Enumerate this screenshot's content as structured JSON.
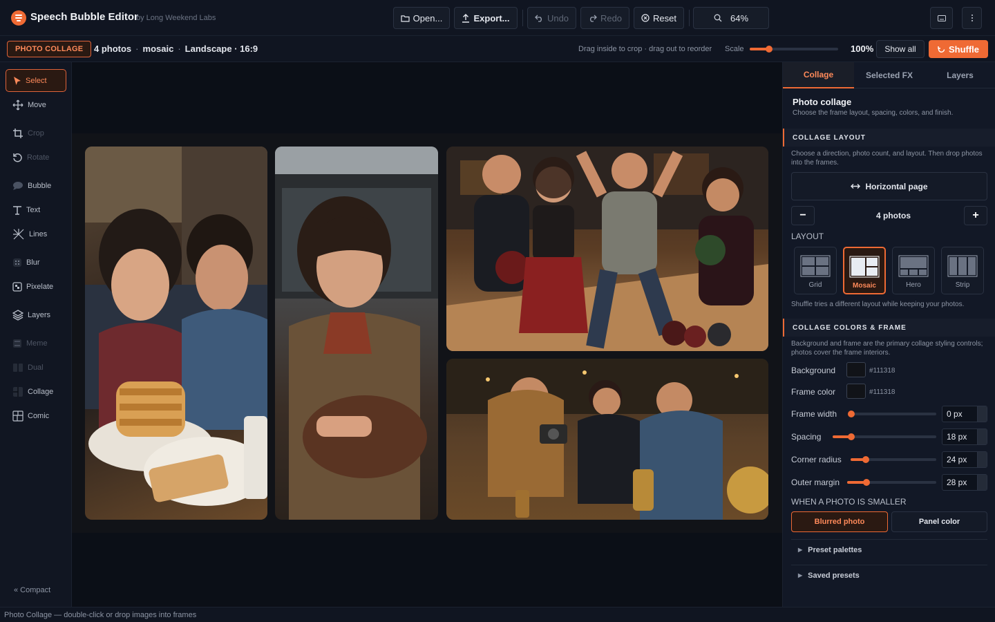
{
  "app": {
    "title": "Speech Bubble Editor",
    "subtitle": "by Long Weekend Labs"
  },
  "toolbar": {
    "open": "Open...",
    "export": "Export...",
    "undo": "Undo",
    "redo": "Redo",
    "reset": "Reset",
    "zoom": "64%"
  },
  "subbar": {
    "mode": "PHOTO COLLAGE",
    "photos": "4 photos",
    "layout": "mosaic",
    "orientation": "Landscape · 16:9",
    "hint": "Drag inside to crop · drag out to reorder",
    "scale_label": "Scale",
    "scale_level": 0.22,
    "scale_value": "100%",
    "show_all": "Show all",
    "shuffle": "Shuffle"
  },
  "tools": [
    {
      "label": "Select",
      "icon": "cursor-icon",
      "active": true,
      "enabled": true
    },
    {
      "label": "Move",
      "icon": "move-icon",
      "enabled": true
    },
    {
      "label": "Crop",
      "icon": "crop-icon",
      "enabled": false
    },
    {
      "label": "Rotate",
      "icon": "rotate-icon",
      "enabled": false
    },
    {
      "label": "Bubble",
      "icon": "bubble-icon",
      "enabled": true
    },
    {
      "label": "Text",
      "icon": "text-icon",
      "enabled": true
    },
    {
      "label": "Lines",
      "icon": "lines-icon",
      "enabled": true
    },
    {
      "label": "Blur",
      "icon": "blur-icon",
      "enabled": true
    },
    {
      "label": "Pixelate",
      "icon": "pixelate-icon",
      "enabled": true
    },
    {
      "label": "Layers",
      "icon": "layers-icon",
      "enabled": true
    },
    {
      "label": "Meme",
      "icon": "meme-icon",
      "enabled": false
    },
    {
      "label": "Dual",
      "icon": "dual-icon",
      "enabled": false
    },
    {
      "label": "Collage",
      "icon": "collage-icon",
      "enabled": true
    },
    {
      "label": "Comic",
      "icon": "comic-icon",
      "enabled": true
    }
  ],
  "compact": "« Compact",
  "panel": {
    "tabs": [
      "Collage",
      "Selected FX",
      "Layers"
    ],
    "title": "Photo collage",
    "desc": "Choose the frame layout, spacing, colors, and finish.",
    "layout_section": "COLLAGE LAYOUT",
    "layout_help": "Choose a direction, photo count, and layout. Then drop photos into the frames.",
    "direction": "Horizontal page",
    "count": "4 photos",
    "layout_label": "LAYOUT",
    "layouts": [
      "Grid",
      "Mosaic",
      "Hero",
      "Strip"
    ],
    "layout_note": "Shuffle tries a different layout while keeping your photos.",
    "colors_section": "COLLAGE COLORS & FRAME",
    "colors_help": "Background and frame are the primary collage styling controls; photos cover the frame interiors.",
    "background_label": "Background",
    "background_hex": "#111318",
    "frame_color_label": "Frame color",
    "frame_color_hex": "#111318",
    "frame_width_label": "Frame width",
    "frame_width": "0 px",
    "spacing_label": "Spacing",
    "spacing": "18 px",
    "corner_label": "Corner radius",
    "corner": "24 px",
    "margin_label": "Outer margin",
    "margin": "28 px",
    "smaller_label": "WHEN A PHOTO IS SMALLER",
    "blurred": "Blurred photo",
    "panel_color": "Panel color",
    "preset_palettes": "Preset palettes",
    "saved_presets": "Saved presets"
  },
  "status": "Photo Collage — double-click or drop images into frames",
  "colors": {
    "accent": "#ef6a34",
    "bg": "#0b0f17",
    "panel": "#121826"
  }
}
